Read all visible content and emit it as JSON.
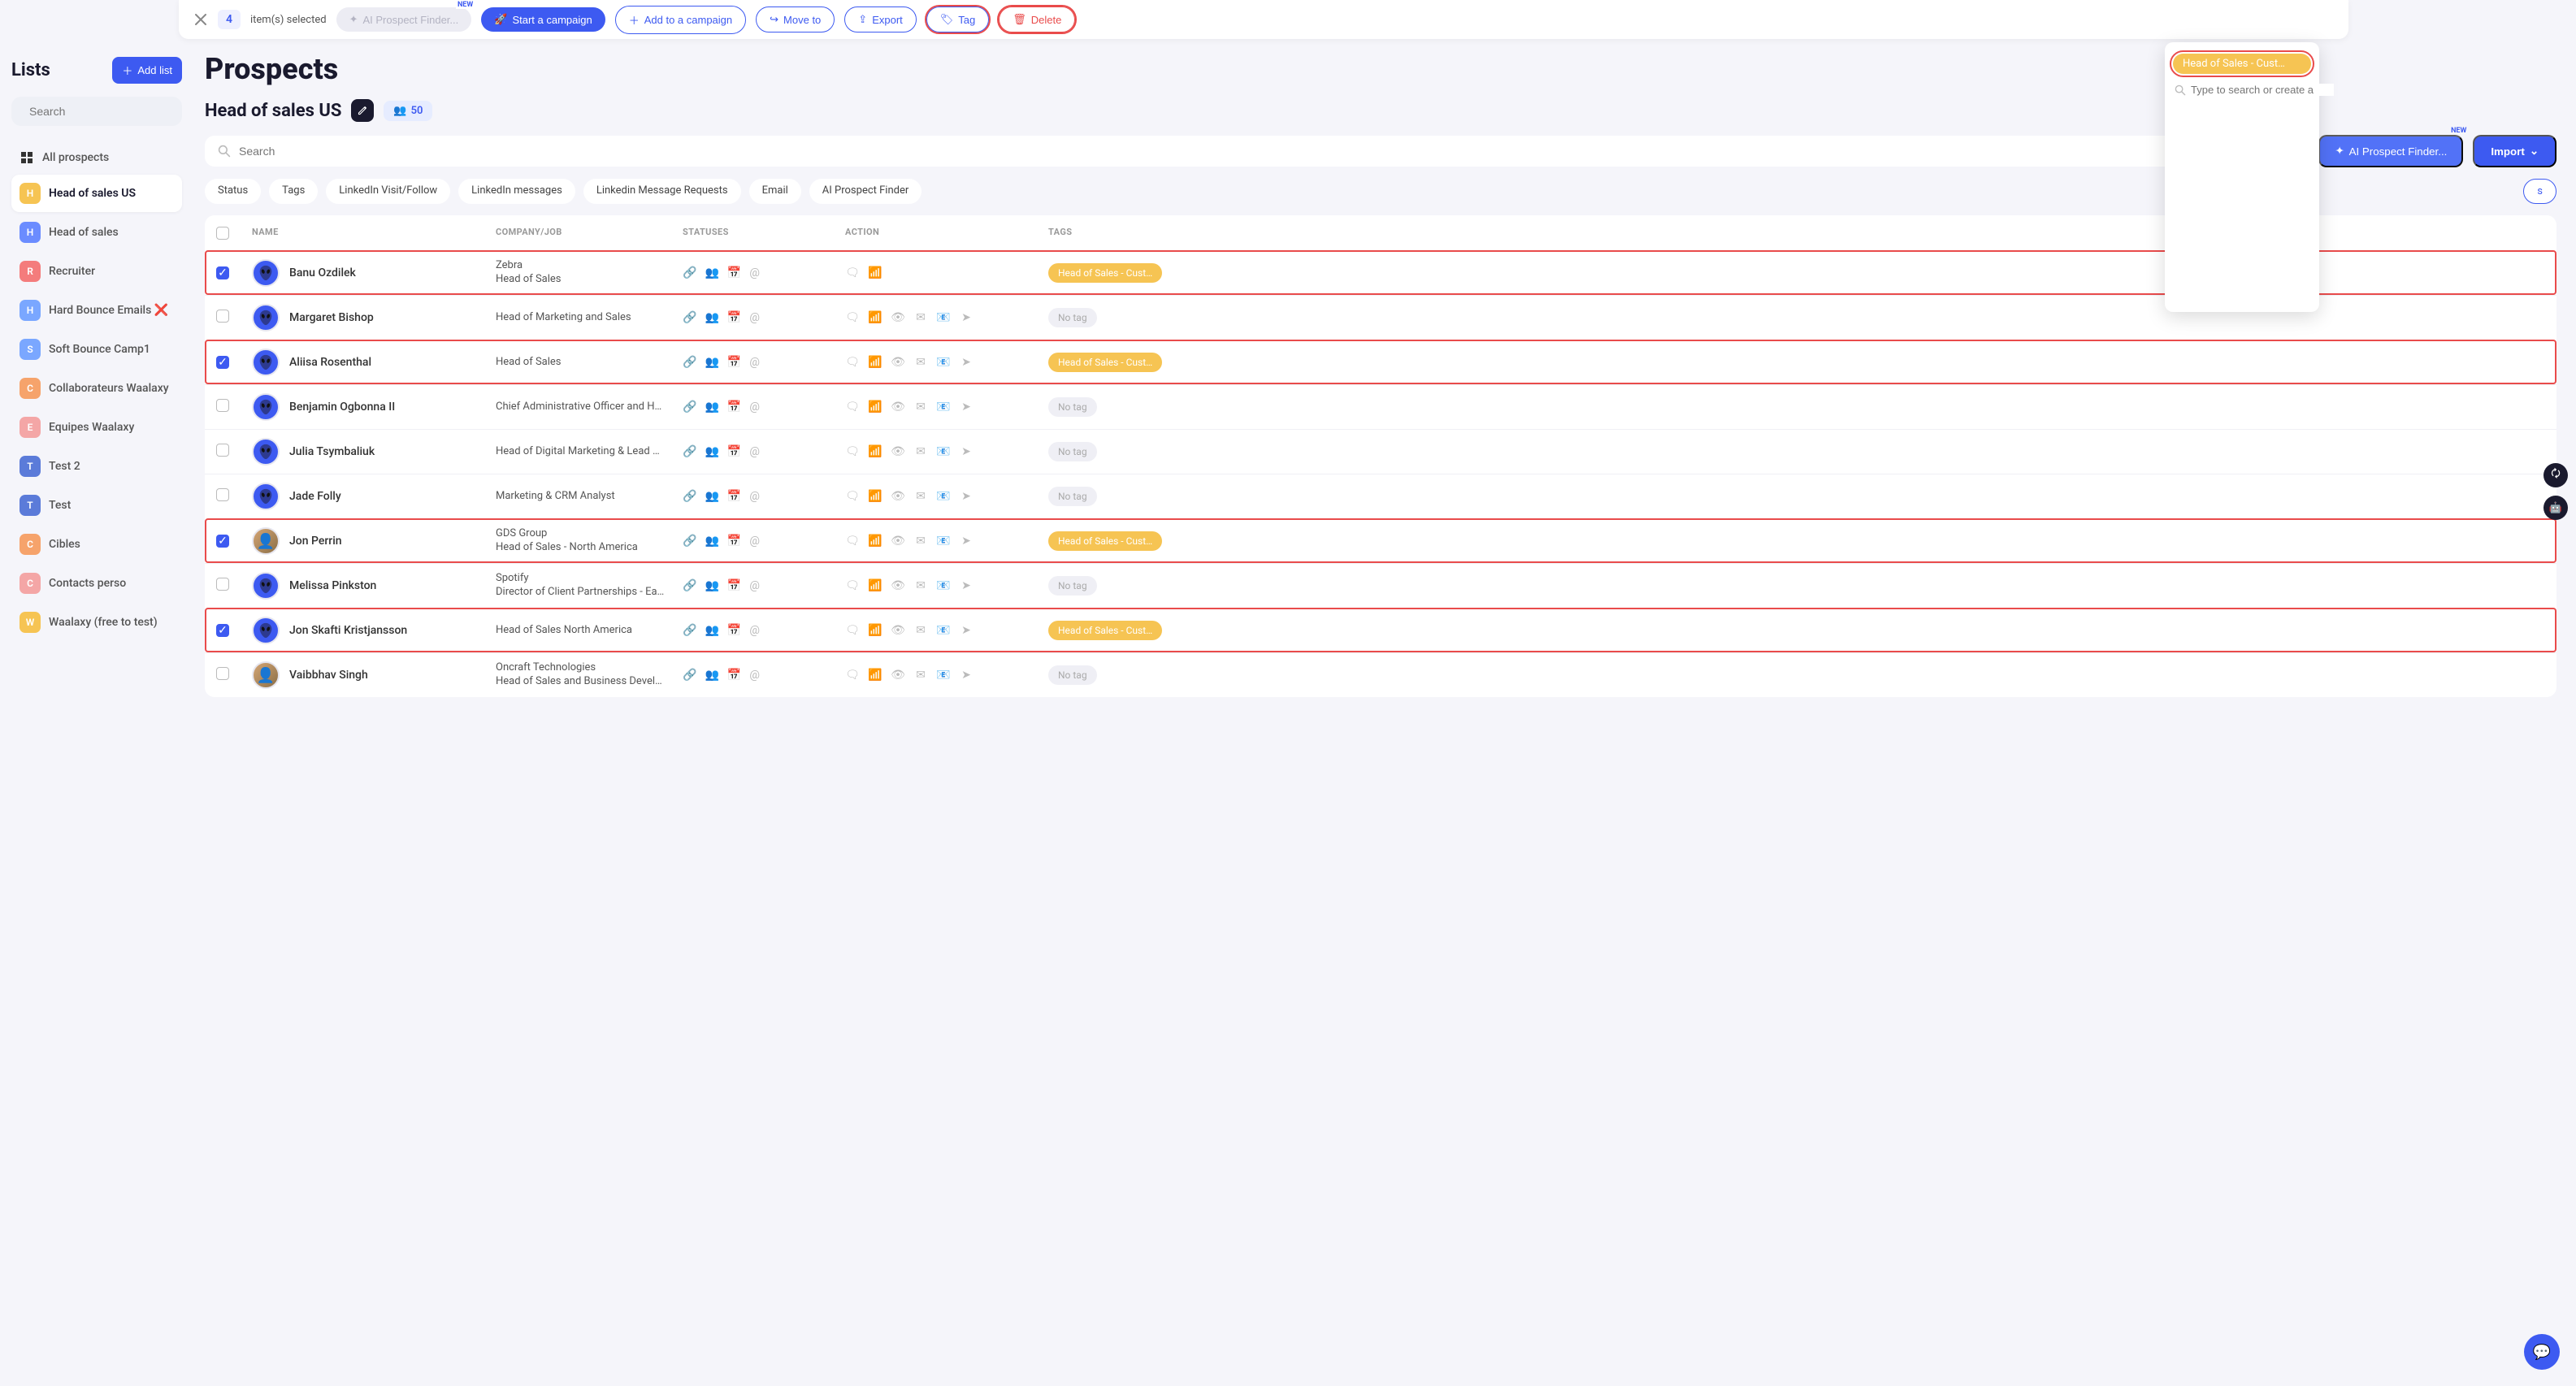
{
  "action_bar": {
    "count": "4",
    "selected_text": "item(s) selected",
    "ai_btn": "AI Prospect Finder...",
    "new_badge": "NEW",
    "start_campaign": "Start a campaign",
    "add_campaign": "Add to a campaign",
    "move_to": "Move to",
    "export": "Export",
    "tag": "Tag",
    "delete": "Delete"
  },
  "tag_dropdown": {
    "existing": "Head of Sales - Cust…",
    "search_placeholder": "Type to search or create a"
  },
  "sidebar": {
    "title": "Lists",
    "add_list": "Add list",
    "search_placeholder": "Search",
    "all_prospects": "All prospects",
    "items": [
      {
        "letter": "H",
        "color": "lb-yellow",
        "label": "Head of sales US",
        "extra": ""
      },
      {
        "letter": "H",
        "color": "lb-blue",
        "label": "Head of sales",
        "extra": ""
      },
      {
        "letter": "R",
        "color": "lb-red",
        "label": "Recruiter",
        "extra": ""
      },
      {
        "letter": "H",
        "color": "lb-sblue",
        "label": "Hard Bounce Emails",
        "extra": "❌"
      },
      {
        "letter": "S",
        "color": "lb-sblue",
        "label": "Soft Bounce Camp1",
        "extra": ""
      },
      {
        "letter": "C",
        "color": "lb-orange",
        "label": "Collaborateurs Waalaxy",
        "extra": ""
      },
      {
        "letter": "E",
        "color": "lb-coral",
        "label": "Equipes Waalaxy",
        "extra": ""
      },
      {
        "letter": "T",
        "color": "lb-dblue",
        "label": "Test 2",
        "extra": ""
      },
      {
        "letter": "T",
        "color": "lb-dblue",
        "label": "Test",
        "extra": ""
      },
      {
        "letter": "C",
        "color": "lb-orange",
        "label": "Cibles",
        "extra": ""
      },
      {
        "letter": "C",
        "color": "lb-coral",
        "label": "Contacts perso",
        "extra": ""
      },
      {
        "letter": "W",
        "color": "lb-yellow",
        "label": "Waalaxy (free to test)",
        "extra": ""
      }
    ]
  },
  "main": {
    "title": "Prospects",
    "list_name": "Head of sales US",
    "count": "50",
    "search_placeholder": "Search",
    "ai_finder": "AI Prospect Finder...",
    "new_badge": "NEW",
    "import": "Import"
  },
  "filters": [
    "Status",
    "Tags",
    "LinkedIn Visit/Follow",
    "LinkedIn messages",
    "Linkedin Message Requests",
    "Email",
    "AI Prospect Finder"
  ],
  "filter_tail": "s",
  "columns": {
    "name": "NAME",
    "company": "COMPANY/JOB",
    "statuses": "STATUSES",
    "actions": "ACTION",
    "tags": "TAGS"
  },
  "tag_value": "Head of Sales - Cust…",
  "no_tag": "No tag",
  "prospects": [
    {
      "checked": true,
      "highlighted": true,
      "avatar": "alien",
      "name": "Banu Ozdilek",
      "company": "Zebra",
      "job": "Head of Sales",
      "actions_full": false
    },
    {
      "checked": false,
      "highlighted": false,
      "avatar": "alien",
      "name": "Margaret Bishop",
      "company": "",
      "job": "Head of Marketing and Sales",
      "actions_full": true
    },
    {
      "checked": true,
      "highlighted": true,
      "avatar": "alien",
      "name": "Aliisa Rosenthal",
      "company": "",
      "job": "Head of Sales",
      "actions_full": true
    },
    {
      "checked": false,
      "highlighted": false,
      "avatar": "alien",
      "name": "Benjamin Ogbonna II",
      "company": "",
      "job": "Chief Administrative Officer and Head of …",
      "actions_full": true
    },
    {
      "checked": false,
      "highlighted": false,
      "avatar": "alien",
      "name": "Julia Tsymbaliuk",
      "company": "",
      "job": "Head of Digital Marketing & Lead Genera…",
      "actions_full": true
    },
    {
      "checked": false,
      "highlighted": false,
      "avatar": "alien",
      "name": "Jade Folly",
      "company": "",
      "job": "Marketing & CRM Analyst",
      "actions_full": true
    },
    {
      "checked": true,
      "highlighted": true,
      "avatar": "photo",
      "name": "Jon Perrin",
      "company": "GDS Group",
      "job": "Head of Sales - North America",
      "actions_full": true
    },
    {
      "checked": false,
      "highlighted": false,
      "avatar": "alien",
      "name": "Melissa Pinkston",
      "company": "Spotify",
      "job": "Director of Client Partnerships - East at …",
      "actions_full": true
    },
    {
      "checked": true,
      "highlighted": true,
      "avatar": "alien",
      "name": "Jon Skafti Kristjansson",
      "company": "",
      "job": "Head of Sales North America",
      "actions_full": true
    },
    {
      "checked": false,
      "highlighted": false,
      "avatar": "photo",
      "name": "Vaibbhav Singh",
      "company": "Oncraft Technologies",
      "job": "Head of Sales and Business Development",
      "actions_full": true
    }
  ]
}
